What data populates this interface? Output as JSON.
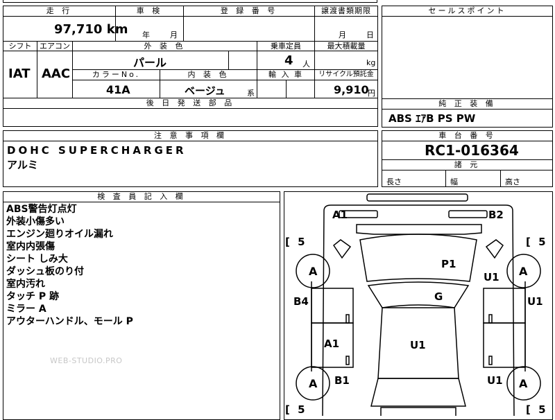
{
  "top_left": {
    "mileage_label": "走 行",
    "mileage_value": "97,710 km",
    "inspection_label": "車 検",
    "inspection_year": "年",
    "inspection_month": "月",
    "registration_label": "登 録 番 号",
    "transfer_label": "譲渡書類期限",
    "transfer_month": "月",
    "transfer_day": "日"
  },
  "specs": {
    "shift_label": "シフト",
    "aircon_label": "エアコン",
    "exterior_label": "外 装 色",
    "capacity_label": "乗車定員",
    "max_load_label": "最大積載量",
    "shift_value": "IAT",
    "aircon_value": "AAC",
    "exterior_value": "パール",
    "capacity_value": "4",
    "capacity_unit": "人",
    "load_unit": "kg",
    "color_no_label": "カラーNo.",
    "interior_label": "内 装 色",
    "import_label": "輸 入 車",
    "recycle_label": "リサイクル預託金",
    "color_no_value": "41A",
    "interior_value": "ベージュ",
    "interior_suffix": "系",
    "recycle_value": "9,910",
    "recycle_unit": "円",
    "later_parts_label": "後 日 発 送 部 品"
  },
  "sales_point_label": "セールスポイント",
  "equipment": {
    "label": "純 正 装 備",
    "value": "ABS ｴｱB PS PW"
  },
  "notes": {
    "label": "注 意 事 項 欄",
    "line1": "DOHC SUPERCHARGER",
    "line2": "アルミ"
  },
  "chassis": {
    "label": "車 台 番 号",
    "value": "RC1-016364",
    "dims_label": "諸 元",
    "length_label": "長さ",
    "width_label": "幅",
    "height_label": "高さ"
  },
  "inspector": {
    "label": "検 査 員 記 入 欄",
    "lines": [
      "ABS警告灯点灯",
      "外装小傷多い",
      "エンジン廻りオイル漏れ",
      "室内内張傷",
      "シート しみ大",
      "ダッシュ板のり付",
      "室内汚れ",
      "タッチ P 跡",
      "ミラー A",
      "アウターハンドル、モール P"
    ]
  },
  "watermark": "WEB-STUDIO.PRO",
  "diagram": {
    "marks": [
      "A1",
      "B2",
      "P1",
      "U1",
      "G",
      "U1",
      "B4",
      "A1",
      "U1",
      "B1",
      "U1"
    ],
    "tire_marks": [
      "A",
      "A",
      "A",
      "A"
    ],
    "tire_depths": [
      "5",
      "5",
      "5",
      "5"
    ],
    "tire_unit_left": "[",
    "tire_unit_right": "]"
  }
}
